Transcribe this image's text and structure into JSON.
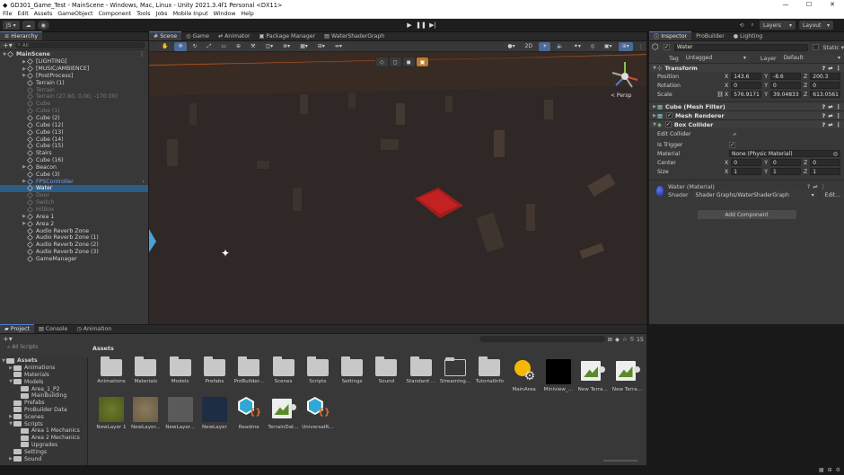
{
  "window": {
    "title": "GD301_Game_Test - MainScene - Windows, Mac, Linux - Unity 2021.3.4f1 Personal <DX11>",
    "min": "—",
    "max": "☐",
    "close": "✕"
  },
  "menu": [
    "File",
    "Edit",
    "Assets",
    "GameObject",
    "Component",
    "Tools",
    "Jobs",
    "Mobile Input",
    "Window",
    "Help"
  ],
  "toolbar": {
    "account": "JS",
    "layers": "Layers",
    "layout": "Layout"
  },
  "hierarchy": {
    "tab": "Hierarchy",
    "search_placeholder": "All",
    "items": [
      {
        "label": "MainScene",
        "indent": 0,
        "arrow": "▼",
        "style": "scene"
      },
      {
        "label": "[LIGHTING]",
        "indent": 2,
        "arrow": "▶",
        "style": ""
      },
      {
        "label": "[MUSIC/AMBIENCE]",
        "indent": 2,
        "arrow": "▶",
        "style": ""
      },
      {
        "label": "[PostProcess]",
        "indent": 2,
        "arrow": "▶",
        "style": ""
      },
      {
        "label": "Terrain (1)",
        "indent": 2,
        "arrow": "",
        "style": ""
      },
      {
        "label": "Terrain",
        "indent": 2,
        "arrow": "",
        "style": "dim"
      },
      {
        "label": "Terrain (27.80, 0.00, -170.00)",
        "indent": 2,
        "arrow": "",
        "style": "dim"
      },
      {
        "label": "Cube",
        "indent": 2,
        "arrow": "",
        "style": "dim"
      },
      {
        "label": "Cube (1)",
        "indent": 2,
        "arrow": "",
        "style": "dim"
      },
      {
        "label": "Cube (2)",
        "indent": 2,
        "arrow": "",
        "style": ""
      },
      {
        "label": "Cube (12)",
        "indent": 2,
        "arrow": "",
        "style": ""
      },
      {
        "label": "Cube (13)",
        "indent": 2,
        "arrow": "",
        "style": ""
      },
      {
        "label": "Cube (14)",
        "indent": 2,
        "arrow": "",
        "style": ""
      },
      {
        "label": "Cube (15)",
        "indent": 2,
        "arrow": "",
        "style": ""
      },
      {
        "label": "Stairs",
        "indent": 2,
        "arrow": "",
        "style": ""
      },
      {
        "label": "Cube (16)",
        "indent": 2,
        "arrow": "",
        "style": ""
      },
      {
        "label": "Beacon",
        "indent": 2,
        "arrow": "▶",
        "style": ""
      },
      {
        "label": "Cube (3)",
        "indent": 2,
        "arrow": "",
        "style": ""
      },
      {
        "label": "FPSController",
        "indent": 2,
        "arrow": "▶",
        "style": "blue"
      },
      {
        "label": "Water",
        "indent": 2,
        "arrow": "",
        "style": "sel"
      },
      {
        "label": "Door",
        "indent": 2,
        "arrow": "",
        "style": "dim"
      },
      {
        "label": "Switch",
        "indent": 2,
        "arrow": "",
        "style": "dim"
      },
      {
        "label": "HitBox",
        "indent": 2,
        "arrow": "",
        "style": "dim"
      },
      {
        "label": "Area 1",
        "indent": 2,
        "arrow": "▶",
        "style": ""
      },
      {
        "label": "Area 2",
        "indent": 2,
        "arrow": "▶",
        "style": ""
      },
      {
        "label": "Audio Reverb Zone",
        "indent": 2,
        "arrow": "",
        "style": ""
      },
      {
        "label": "Audio Reverb Zone (1)",
        "indent": 2,
        "arrow": "",
        "style": ""
      },
      {
        "label": "Audio Reverb Zone (2)",
        "indent": 2,
        "arrow": "",
        "style": ""
      },
      {
        "label": "Audio Reverb Zone (3)",
        "indent": 2,
        "arrow": "",
        "style": ""
      },
      {
        "label": "GameManager",
        "indent": 2,
        "arrow": "",
        "style": ""
      }
    ]
  },
  "scene": {
    "tabs": [
      "Scene",
      "Game",
      "Animator",
      "Package Manager",
      "WaterShaderGraph"
    ],
    "persp_label": "< Persp"
  },
  "inspector": {
    "tabs": [
      "Inspector",
      "ProBuilder",
      "Lighting"
    ],
    "object_name": "Water",
    "static_label": "Static",
    "tag_label": "Tag",
    "tag_value": "Untagged",
    "layer_label": "Layer",
    "layer_value": "Default",
    "transform": {
      "title": "Transform",
      "position_label": "Position",
      "pos": [
        "143.6",
        "-8.6",
        "200.3"
      ],
      "rotation_label": "Rotation",
      "rot": [
        "0",
        "0",
        "0"
      ],
      "scale_label": "Scale",
      "scale": [
        "576.9171",
        "39.04833",
        "613.0561"
      ]
    },
    "mesh_filter": "Cube (Mesh Filter)",
    "mesh_renderer": "Mesh Renderer",
    "box_collider": {
      "title": "Box Collider",
      "edit_label": "Edit Collider",
      "trigger_label": "Is Trigger",
      "material_label": "Material",
      "material_value": "None (Physic Material)",
      "center_label": "Center",
      "center": [
        "0",
        "0",
        "0"
      ],
      "size_label": "Size",
      "size": [
        "1",
        "1",
        "1"
      ]
    },
    "material": {
      "name": "Water (Material)",
      "shader_label": "Shader",
      "shader_value": "Shader Graphs/WaterShaderGraph",
      "edit_label": "Edit..."
    },
    "add_component": "Add Component"
  },
  "project": {
    "tabs": [
      "Project",
      "Console",
      "Animation"
    ],
    "count": "15",
    "breadcrumb": "Assets",
    "tree_top": "All Scripts",
    "tree": [
      {
        "label": "Assets",
        "indent": 0,
        "arrow": "▼",
        "bold": true
      },
      {
        "label": "Animations",
        "indent": 1,
        "arrow": "▶"
      },
      {
        "label": "Materials",
        "indent": 1,
        "arrow": ""
      },
      {
        "label": "Models",
        "indent": 1,
        "arrow": "▼"
      },
      {
        "label": "Area_1_P2",
        "indent": 2,
        "arrow": ""
      },
      {
        "label": "MainBuilding",
        "indent": 2,
        "arrow": ""
      },
      {
        "label": "Prefabs",
        "indent": 1,
        "arrow": ""
      },
      {
        "label": "ProBuilder Data",
        "indent": 1,
        "arrow": ""
      },
      {
        "label": "Scenes",
        "indent": 1,
        "arrow": "▶"
      },
      {
        "label": "Scripts",
        "indent": 1,
        "arrow": "▼"
      },
      {
        "label": "Area 1 Mechanics",
        "indent": 2,
        "arrow": ""
      },
      {
        "label": "Area 2 Mechanics",
        "indent": 2,
        "arrow": ""
      },
      {
        "label": "Upgrades",
        "indent": 2,
        "arrow": ""
      },
      {
        "label": "Settings",
        "indent": 1,
        "arrow": ""
      },
      {
        "label": "Sound",
        "indent": 1,
        "arrow": "▶"
      }
    ],
    "row1": [
      {
        "name": "Animations",
        "kind": "folder"
      },
      {
        "name": "Materials",
        "kind": "folder"
      },
      {
        "name": "Models",
        "kind": "folder"
      },
      {
        "name": "Prefabs",
        "kind": "folder"
      },
      {
        "name": "ProBuilder...",
        "kind": "folder"
      },
      {
        "name": "Scenes",
        "kind": "folder"
      },
      {
        "name": "Scripts",
        "kind": "folder"
      },
      {
        "name": "Settings",
        "kind": "folder"
      },
      {
        "name": "Sound",
        "kind": "folder"
      },
      {
        "name": "Standard ...",
        "kind": "folder"
      },
      {
        "name": "Streaming...",
        "kind": "folder-empty"
      },
      {
        "name": "TutorialInfo",
        "kind": "folder"
      },
      {
        "name": "MainArea",
        "kind": "scene-settings"
      },
      {
        "name": "Miniview_...",
        "kind": "black"
      },
      {
        "name": "New Terra...",
        "kind": "terrain"
      },
      {
        "name": "New Terra...",
        "kind": "terrain"
      }
    ],
    "row2": [
      {
        "name": "NewLayer 1",
        "kind": "grass"
      },
      {
        "name": "NewLayer...",
        "kind": "rock"
      },
      {
        "name": "NewLayer...",
        "kind": "gray"
      },
      {
        "name": "NewLayer",
        "kind": "navy"
      },
      {
        "name": "Readme",
        "kind": "script"
      },
      {
        "name": "TerrainDat...",
        "kind": "terrain"
      },
      {
        "name": "UniversalR...",
        "kind": "script"
      }
    ]
  }
}
